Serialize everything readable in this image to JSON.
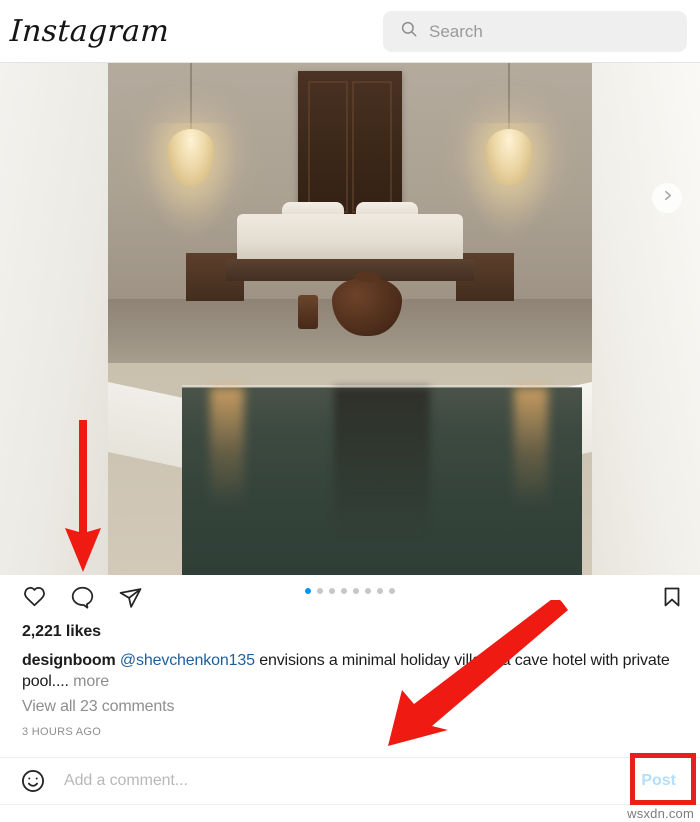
{
  "header": {
    "logo_text": "Instagram",
    "search": {
      "placeholder": "Search",
      "value": "",
      "icon": "search-icon"
    }
  },
  "post": {
    "image_alt": "minimal cave hotel bedroom with private pool",
    "next_arrow_icon": "chevron-right-icon",
    "carousel": {
      "total_dots": 8,
      "active_index": 0
    },
    "actions": {
      "like_icon": "heart-icon",
      "comment_icon": "comment-bubble-icon",
      "share_icon": "paper-plane-icon",
      "save_icon": "bookmark-icon"
    },
    "likes": "2,221 likes",
    "caption": {
      "username": "designboom",
      "mention": "@shevchenkon135",
      "text": " envisions a minimal holiday villa in a cave hotel with private pool....",
      "more_label": "more"
    },
    "view_comments": "View all 23 comments",
    "timestamp": "3 HOURS AGO"
  },
  "comment_bar": {
    "emoji_icon": "smiley-face-icon",
    "input_placeholder": "Add a comment...",
    "input_value": "",
    "post_label": "Post"
  },
  "annotations": {
    "arrow_down_target": "comment-bubble-icon",
    "arrow_diagonal_target": "add-a-comment-input",
    "arrow_color": "#ef1a12",
    "highlight_color": "#e8201a",
    "highlight_target": "post-button"
  },
  "watermark": "wsxdn.com",
  "colors": {
    "accent_blue": "#0095f6",
    "link_blue": "#1d5f9e",
    "post_disabled": "#b2dffc",
    "muted_gray": "#8e8e8e",
    "search_bg": "#efefef"
  }
}
